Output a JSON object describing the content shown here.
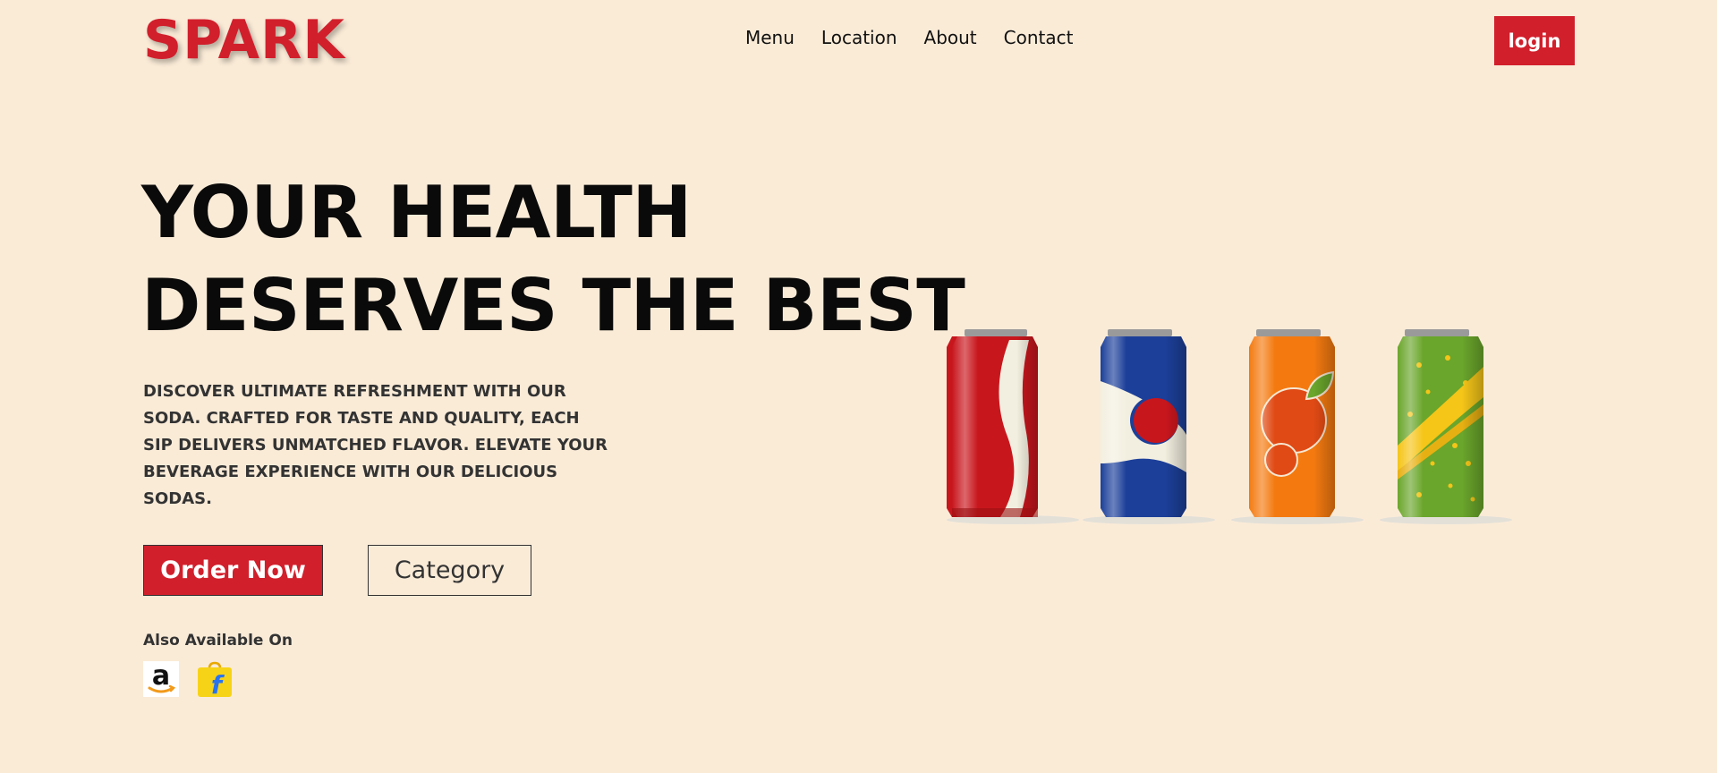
{
  "header": {
    "logo": "SPARK",
    "nav": [
      "Menu",
      "Location",
      "About",
      "Contact"
    ],
    "login_label": "login"
  },
  "hero": {
    "headline_line1": "YOUR HEALTH",
    "headline_line2": "DESERVES THE BEST",
    "description": "DISCOVER ULTIMATE REFRESHMENT WITH OUR SODA. CRAFTED FOR TASTE AND QUALITY, EACH SIP DELIVERS UNMATCHED FLAVOR. ELEVATE YOUR BEVERAGE EXPERIENCE WITH OUR DELICIOUS SODAS.",
    "order_label": "Order Now",
    "category_label": "Category",
    "also_available": "Also Available On"
  },
  "stores": [
    {
      "name": "amazon",
      "icon": "amazon-icon"
    },
    {
      "name": "flipkart",
      "icon": "flipkart-icon"
    }
  ],
  "cans": [
    {
      "name": "cola",
      "body": "#c8161d",
      "accent": "#f3efe0"
    },
    {
      "name": "blue",
      "body": "#1c3f99",
      "accent": "#f3efe0"
    },
    {
      "name": "orange",
      "body": "#f47a10",
      "accent": "#e05010"
    },
    {
      "name": "lime",
      "body": "#6aa62b",
      "accent": "#f5c518"
    }
  ],
  "colors": {
    "background": "#faebd7",
    "brand_red": "#d11f2c",
    "text": "#111111"
  }
}
